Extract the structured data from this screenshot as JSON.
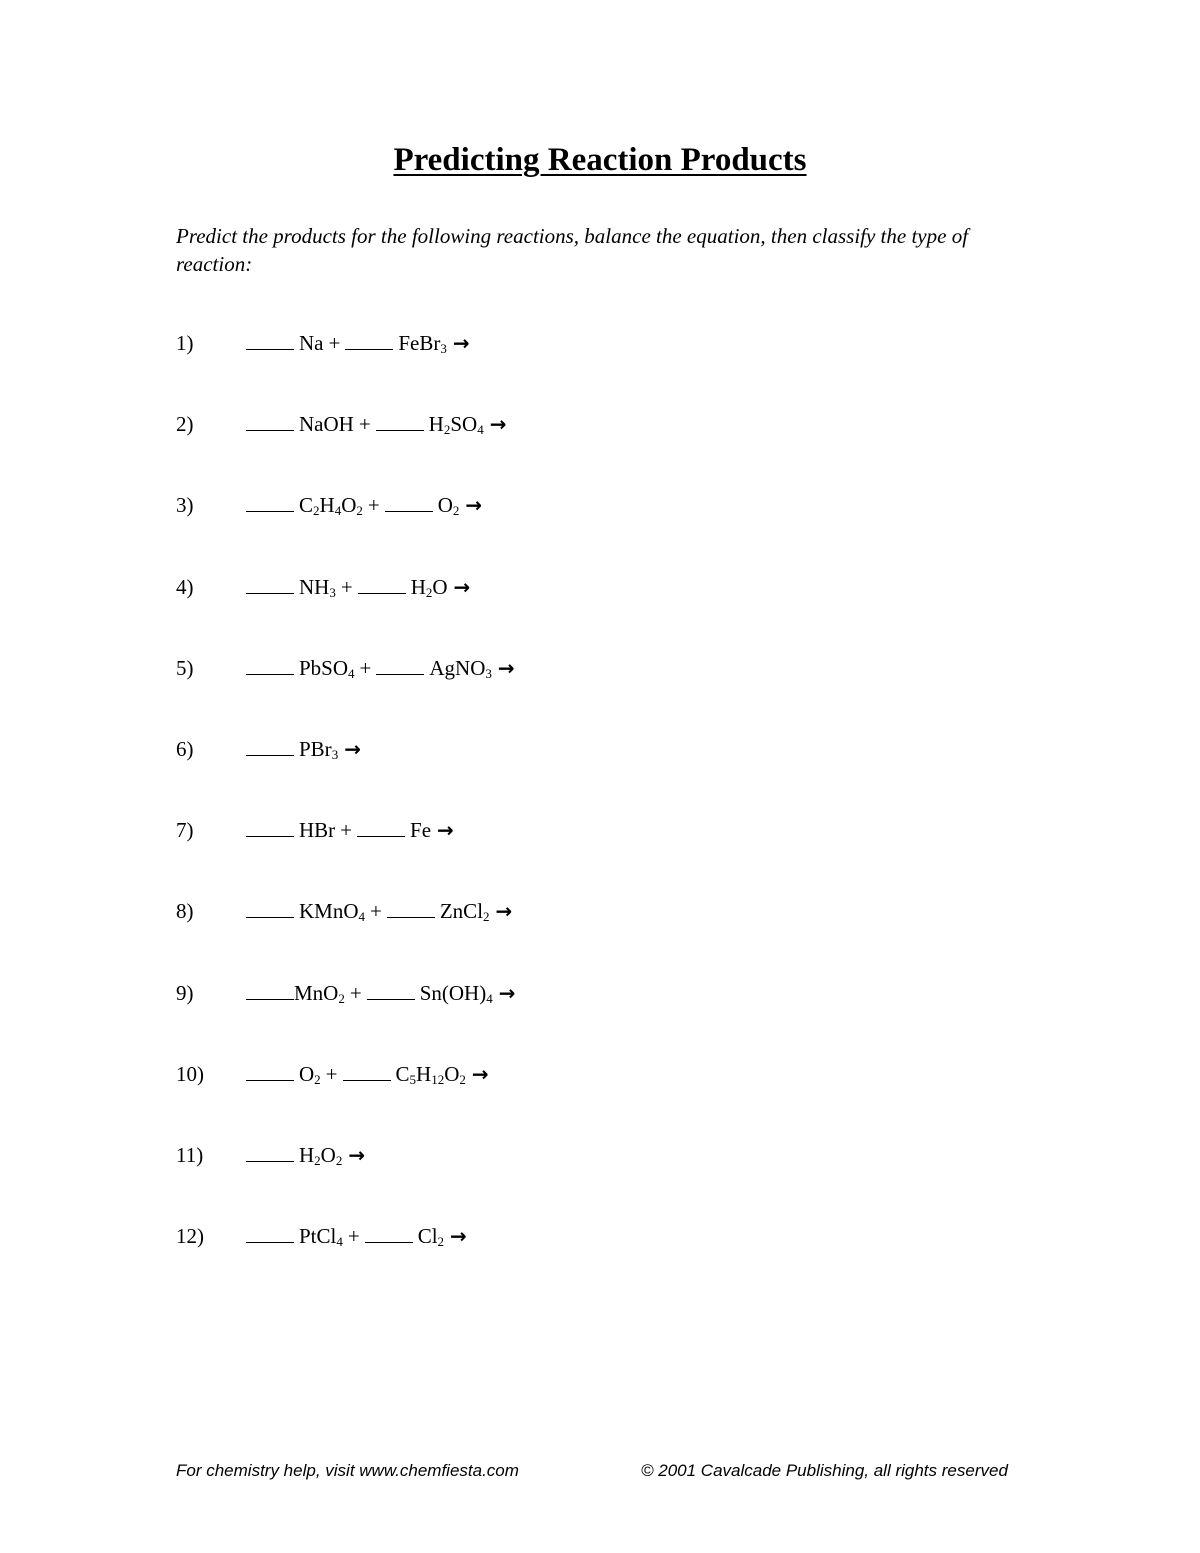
{
  "title": "Predicting Reaction Products",
  "instructions": "Predict the products for the following reactions, balance the equation, then classify the type of reaction:",
  "arrow_icon": "right-arrow",
  "questions": [
    {
      "number": "1)",
      "reactants": [
        {
          "parts": [
            [
              "Na",
              ""
            ]
          ]
        },
        {
          "parts": [
            [
              "FeBr",
              "3"
            ]
          ]
        }
      ]
    },
    {
      "number": "2)",
      "reactants": [
        {
          "parts": [
            [
              "NaOH",
              ""
            ]
          ]
        },
        {
          "parts": [
            [
              "H",
              "2"
            ],
            [
              "SO",
              "4"
            ]
          ]
        }
      ]
    },
    {
      "number": "3)",
      "reactants": [
        {
          "parts": [
            [
              "C",
              "2"
            ],
            [
              "H",
              "4"
            ],
            [
              "O",
              "2"
            ]
          ]
        },
        {
          "parts": [
            [
              "O",
              "2"
            ]
          ]
        }
      ]
    },
    {
      "number": "4)",
      "reactants": [
        {
          "parts": [
            [
              "NH",
              "3"
            ]
          ]
        },
        {
          "parts": [
            [
              "H",
              "2"
            ],
            [
              "O",
              ""
            ]
          ]
        }
      ]
    },
    {
      "number": "5)",
      "reactants": [
        {
          "parts": [
            [
              "PbSO",
              "4"
            ]
          ]
        },
        {
          "parts": [
            [
              "AgNO",
              "3"
            ]
          ]
        }
      ]
    },
    {
      "number": "6)",
      "reactants": [
        {
          "parts": [
            [
              "PBr",
              "3"
            ]
          ]
        }
      ]
    },
    {
      "number": "7)",
      "reactants": [
        {
          "parts": [
            [
              "HBr",
              ""
            ]
          ]
        },
        {
          "parts": [
            [
              "Fe",
              ""
            ]
          ]
        }
      ]
    },
    {
      "number": "8)",
      "reactants": [
        {
          "parts": [
            [
              "KMnO",
              "4"
            ]
          ]
        },
        {
          "parts": [
            [
              "ZnCl",
              "2"
            ]
          ]
        }
      ]
    },
    {
      "number": "9)",
      "reactants": [
        {
          "parts": [
            [
              "MnO",
              "2"
            ]
          ],
          "tight": true
        },
        {
          "parts": [
            [
              "Sn(OH)",
              "4"
            ]
          ]
        }
      ]
    },
    {
      "number": "10)",
      "reactants": [
        {
          "parts": [
            [
              "O",
              "2"
            ]
          ]
        },
        {
          "parts": [
            [
              "C",
              "5"
            ],
            [
              "H",
              "12"
            ],
            [
              "O",
              "2"
            ]
          ]
        }
      ]
    },
    {
      "number": "11)",
      "reactants": [
        {
          "parts": [
            [
              "H",
              "2"
            ],
            [
              "O",
              "2"
            ]
          ]
        }
      ]
    },
    {
      "number": "12)",
      "reactants": [
        {
          "parts": [
            [
              "PtCl",
              "4"
            ]
          ]
        },
        {
          "parts": [
            [
              "Cl",
              "2"
            ]
          ]
        }
      ]
    }
  ],
  "plus_sign": "+",
  "arrow_glyph": "→",
  "footer": {
    "left": "For chemistry help, visit www.chemfiesta.com",
    "right": "© 2001 Cavalcade Publishing, all rights reserved"
  }
}
